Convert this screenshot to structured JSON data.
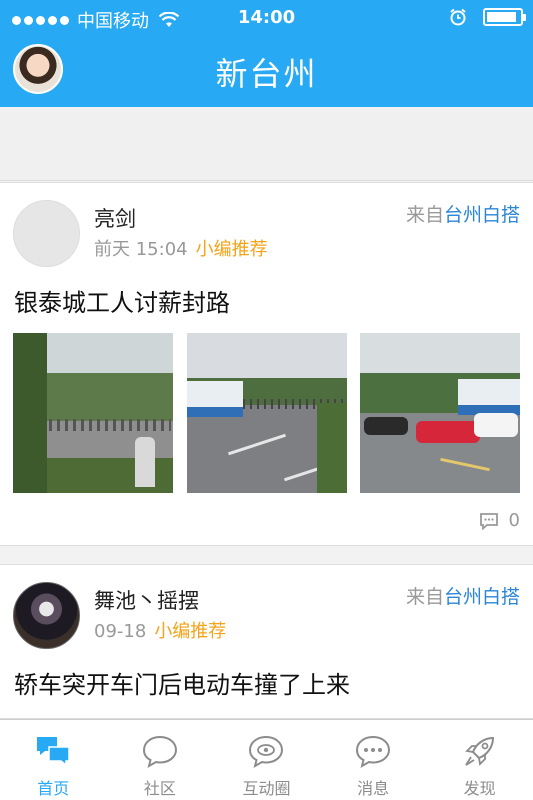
{
  "status_bar": {
    "carrier": "中国移动",
    "time": "14:00"
  },
  "header": {
    "title": "新台州"
  },
  "posts": [
    {
      "username": "亮剑",
      "time": "前天 15:04",
      "tag": "小编推荐",
      "source_prefix": "来自",
      "source_group": "台州白搭",
      "title": "银泰城工人讨薪封路",
      "comment_count": "0"
    },
    {
      "username": "舞池丶摇摆",
      "time": "09-18",
      "tag": "小编推荐",
      "source_prefix": "来自",
      "source_group": "台州白搭",
      "title": "轿车突开车门后电动车撞了上来"
    }
  ],
  "tabs": [
    {
      "label": "首页",
      "icon": "home-chat-icon"
    },
    {
      "label": "社区",
      "icon": "speech-bubble-icon"
    },
    {
      "label": "互动圈",
      "icon": "eye-bubble-icon"
    },
    {
      "label": "消息",
      "icon": "message-dots-icon"
    },
    {
      "label": "发现",
      "icon": "rocket-icon"
    }
  ],
  "colors": {
    "brand": "#27a9f3",
    "tag": "#f5a31a",
    "link": "#2b86d6"
  }
}
